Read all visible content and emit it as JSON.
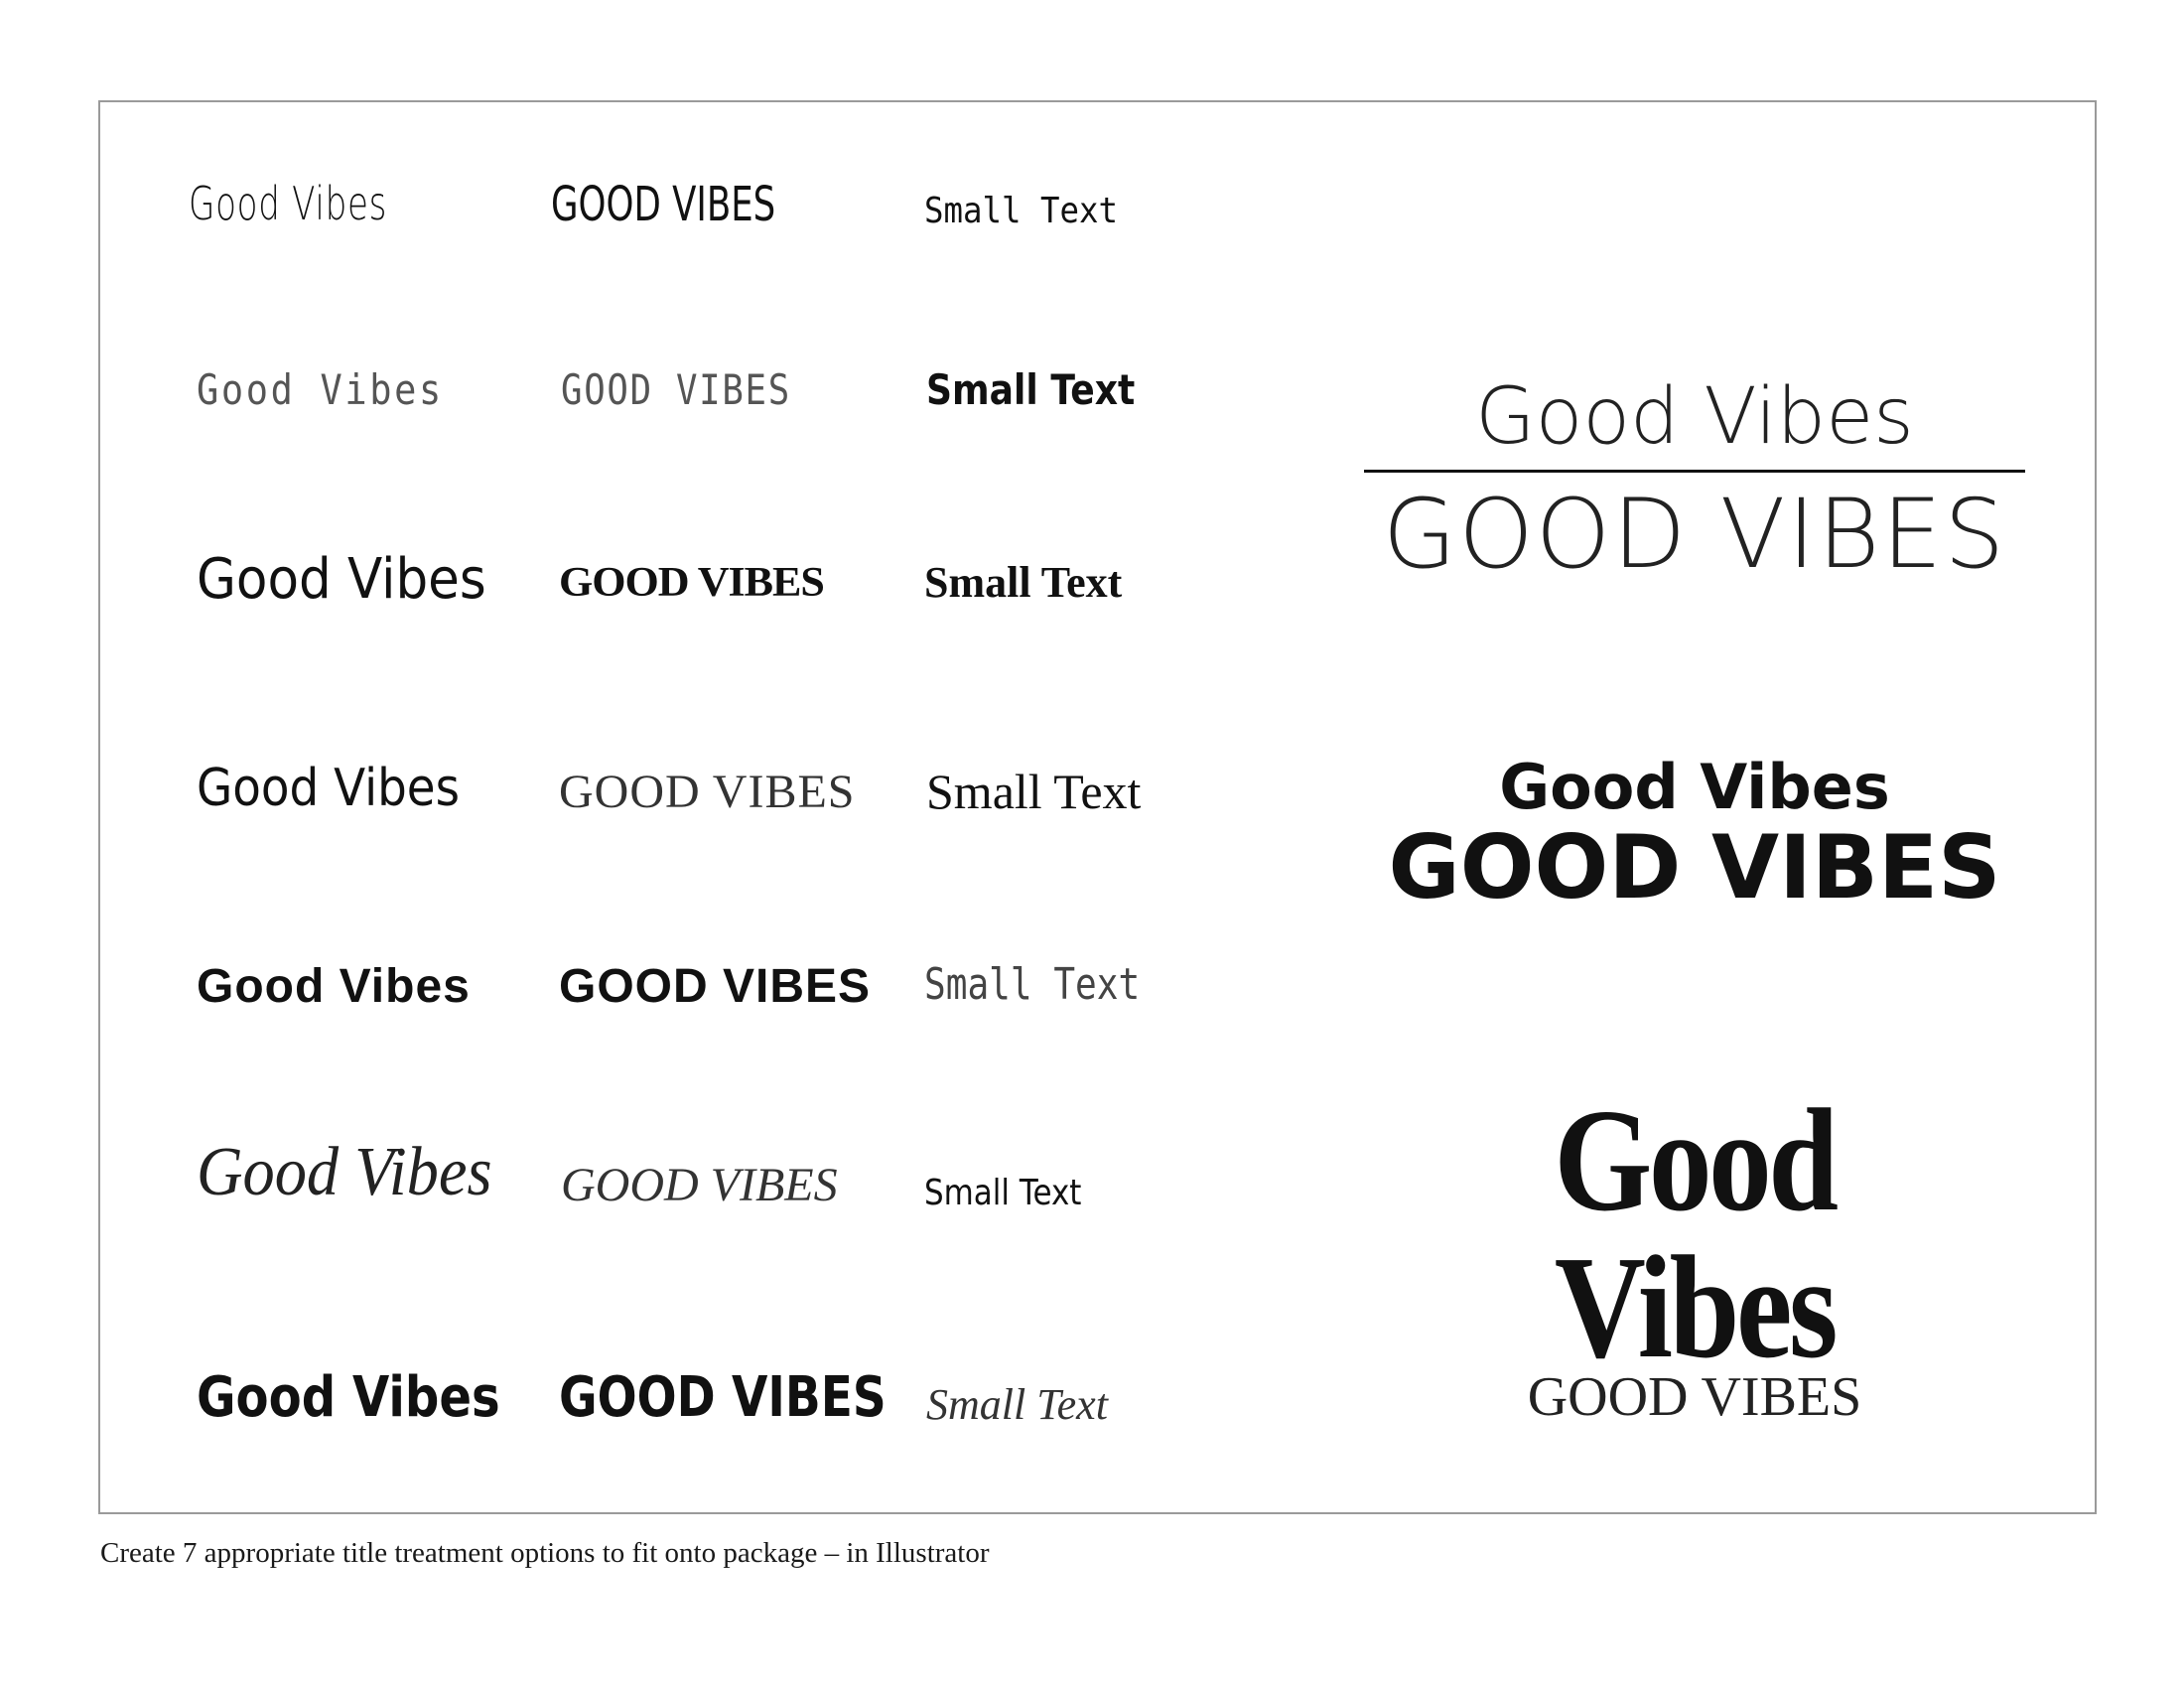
{
  "caption": "Create 7 appropriate title treatment options to fit onto package – in Illustrator",
  "rows": [
    {
      "title": "Good Vibes",
      "caps": "GOOD VIBES",
      "small": "Small Text"
    },
    {
      "title": "Good  Vibes",
      "caps": "GOOD  VIBES",
      "small": "Small Text"
    },
    {
      "title": "Good Vibes",
      "caps": "GOOD VIBES",
      "small": "Small Text"
    },
    {
      "title": "Good Vibes",
      "caps": "GOOD VIBES",
      "small": "Small Text"
    },
    {
      "title": "Good Vibes",
      "caps": "GOOD VIBES",
      "small": "Small Text"
    },
    {
      "title": "Good Vibes",
      "caps": "GOOD VIBES",
      "small": "Small Text"
    },
    {
      "title": "Good Vibes",
      "caps": "GOOD VIBES",
      "small": "Small Text"
    }
  ],
  "lockups": [
    {
      "top": "Good Vibes",
      "bottom": "GOOD VIBES"
    },
    {
      "top": "Good Vibes",
      "bottom": "GOOD VIBES"
    },
    {
      "top": "Good Vibes",
      "bottom": "GOOD VIBES"
    }
  ]
}
